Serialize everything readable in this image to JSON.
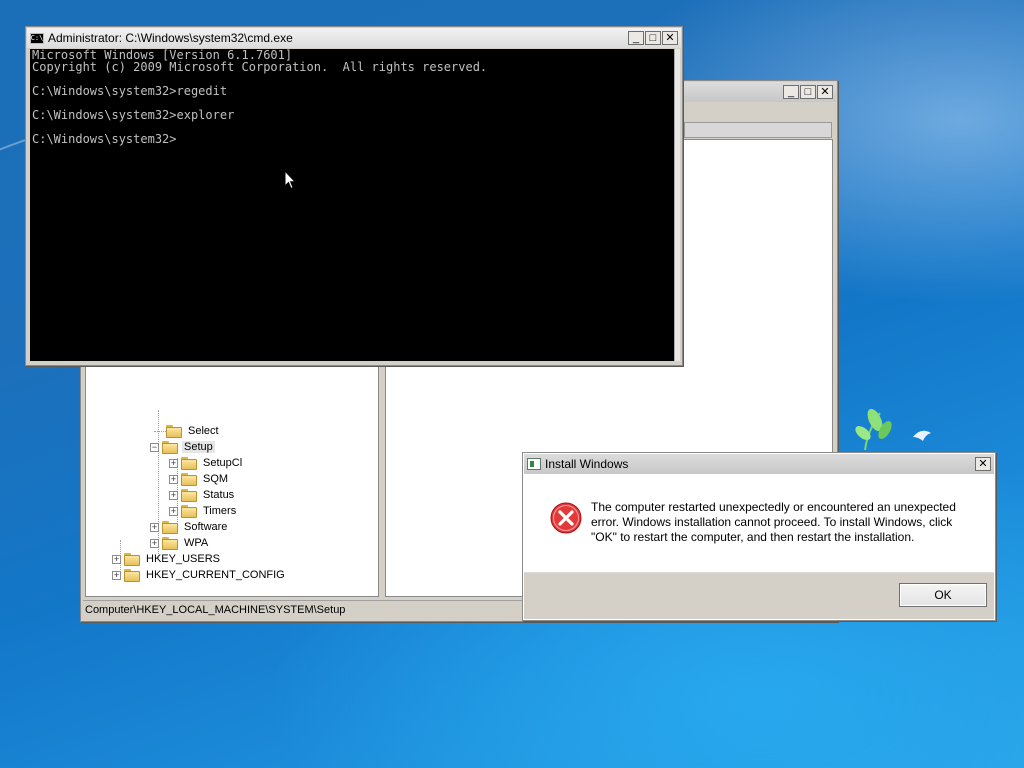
{
  "cmd": {
    "title": "Administrator: C:\\Windows\\system32\\cmd.exe",
    "icon_label": "C:\\",
    "lines": [
      "Microsoft Windows [Version 6.1.7601]",
      "Copyright (c) 2009 Microsoft Corporation.  All rights reserved.",
      "",
      "C:\\Windows\\system32>regedit",
      "",
      "C:\\Windows\\system32>explorer",
      "",
      "C:\\Windows\\system32>"
    ]
  },
  "regedit": {
    "tree": [
      {
        "label": "Select",
        "expander": ""
      },
      {
        "label": "Setup",
        "expander": "−",
        "selected": true
      },
      {
        "label": "SetupCl",
        "expander": "+"
      },
      {
        "label": "SQM",
        "expander": "+"
      },
      {
        "label": "Status",
        "expander": "+"
      },
      {
        "label": "Timers",
        "expander": "+"
      },
      {
        "label": "Software",
        "expander": "+"
      },
      {
        "label": "WPA",
        "expander": "+"
      },
      {
        "label": "HKEY_USERS",
        "expander": "+"
      },
      {
        "label": "HKEY_CURRENT_CONFIG",
        "expander": "+"
      }
    ],
    "status_path": "Computer\\HKEY_LOCAL_MACHINE\\SYSTEM\\Setup"
  },
  "dialog": {
    "title": "Install Windows",
    "message": "The computer restarted unexpectedly or encountered an unexpected error. Windows installation cannot proceed. To install Windows, click \"OK\" to restart the computer, and then restart the installation.",
    "ok_label": "OK",
    "close_label": "✕"
  },
  "caption_buttons": {
    "minimize": "_",
    "maximize": "□",
    "close": "✕"
  },
  "colors": {
    "cmd_text": "#c0c0c0",
    "desktop": "#1d6fba",
    "error_red": "#d42020"
  },
  "icons": {
    "error": "error-x-icon",
    "folder": "folder-icon",
    "cmd": "cmd-icon",
    "setup": "install-windows-icon",
    "cursor": "mouse-pointer-icon"
  }
}
